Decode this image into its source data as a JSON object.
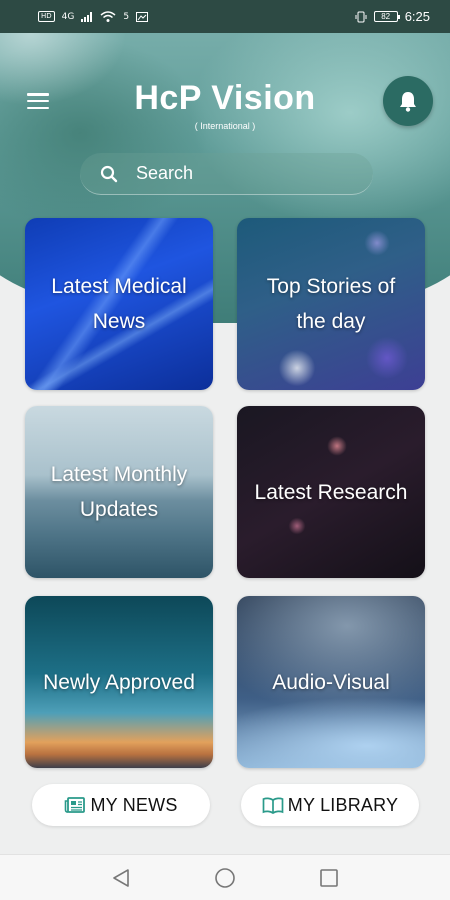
{
  "status_bar": {
    "left_badge": "HD",
    "network": "4G",
    "network_small": "5",
    "battery": "82",
    "time": "6:25"
  },
  "header": {
    "title": "HcP Vision",
    "subtitle": "( International )",
    "menu_icon": "hamburger-menu-icon",
    "notification_icon": "bell-icon"
  },
  "search": {
    "placeholder": "Search",
    "icon": "search-icon"
  },
  "tiles": [
    {
      "label": "Latest Medical News"
    },
    {
      "label": "Top Stories of the day"
    },
    {
      "label": "Latest Monthly Updates"
    },
    {
      "label": "Latest Research"
    },
    {
      "label": "Newly Approved"
    },
    {
      "label": "Audio-Visual"
    }
  ],
  "bottom_buttons": {
    "my_news": "MY NEWS",
    "my_library": "MY LIBRARY"
  },
  "colors": {
    "accent": "#2b6b63",
    "icon_teal": "#2a9a8a",
    "background": "#eeefef"
  }
}
